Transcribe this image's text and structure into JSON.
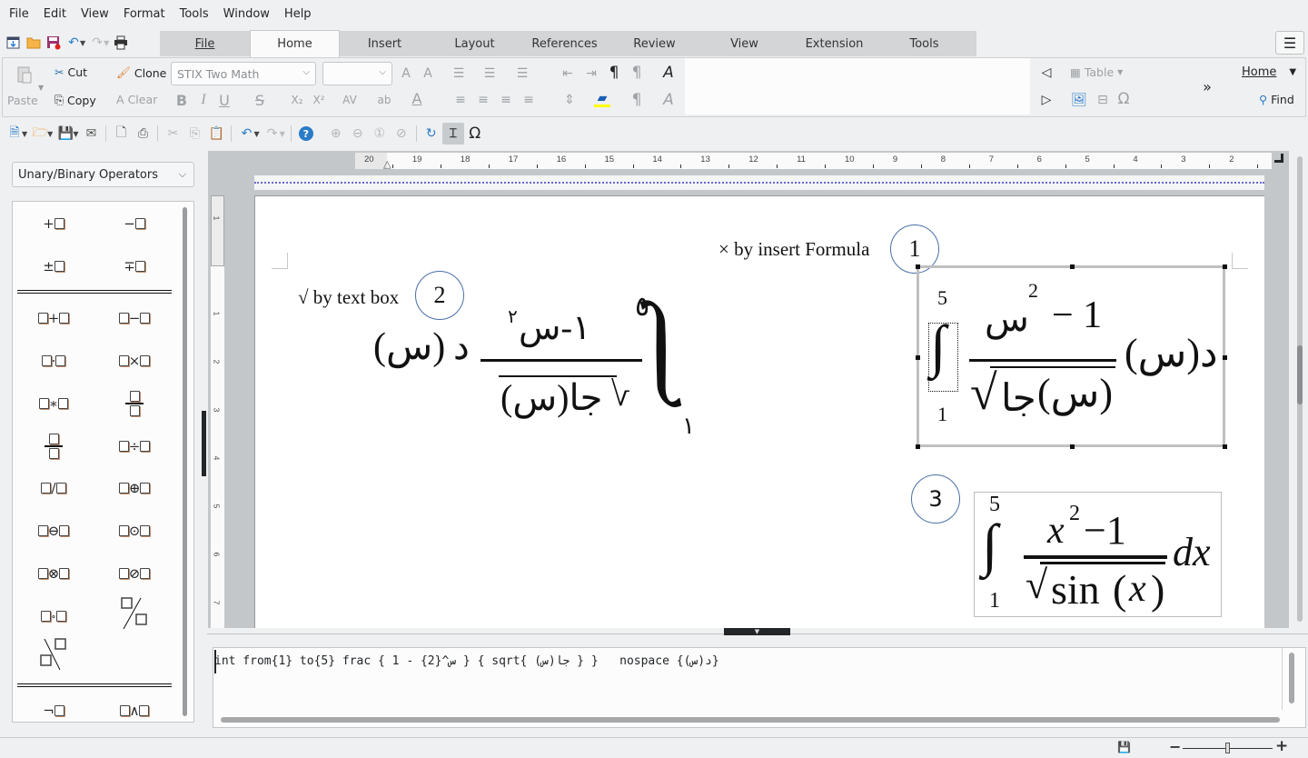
{
  "menubar": {
    "items": [
      "File",
      "Edit",
      "View",
      "Format",
      "Tools",
      "Window",
      "Help"
    ]
  },
  "quick_toolbar": {
    "icons": [
      "new-document-icon",
      "open-folder-icon",
      "save-icon",
      "undo-icon",
      "redo-icon",
      "print-icon"
    ]
  },
  "tabs": [
    {
      "label": "File",
      "active": false
    },
    {
      "label": "Home",
      "active": true
    },
    {
      "label": "Insert",
      "active": false
    },
    {
      "label": "Layout",
      "active": false
    },
    {
      "label": "References",
      "active": false
    },
    {
      "label": "Review",
      "active": false
    },
    {
      "label": "View",
      "active": false
    },
    {
      "label": "Extension",
      "active": false
    },
    {
      "label": "Tools",
      "active": false
    }
  ],
  "ribbon": {
    "paste": "Paste",
    "cut": "Cut",
    "copy": "Copy",
    "clone": "Clone",
    "clear": "Clear",
    "font_name": "STIX Two Math",
    "font_size": "",
    "table": "Table",
    "home_dropdown": "Home",
    "find": "Find",
    "bold": "B",
    "italic": "I",
    "underline": "U",
    "strike": "S",
    "subscript": "X₂",
    "superscript": "X²"
  },
  "sidebar": {
    "category": "Unary/Binary Operators",
    "elements": [
      {
        "name": "unary-plus",
        "sym": "+"
      },
      {
        "name": "unary-minus",
        "sym": "−"
      },
      {
        "name": "plus-minus",
        "sym": "±"
      },
      {
        "name": "minus-plus",
        "sym": "∓"
      },
      {
        "name": "addition",
        "sym": "+"
      },
      {
        "name": "subtraction",
        "sym": "−"
      },
      {
        "name": "multiplication-dot",
        "sym": "·"
      },
      {
        "name": "multiplication-x",
        "sym": "×"
      },
      {
        "name": "multiplication-star",
        "sym": "∗"
      },
      {
        "name": "fraction",
        "sym": "frac"
      },
      {
        "name": "fraction-small",
        "sym": "frac"
      },
      {
        "name": "division",
        "sym": "÷"
      },
      {
        "name": "slash-division",
        "sym": "/"
      },
      {
        "name": "circled-plus",
        "sym": "⊕"
      },
      {
        "name": "circled-minus",
        "sym": "⊖"
      },
      {
        "name": "circled-dot",
        "sym": "⊙"
      },
      {
        "name": "circled-times",
        "sym": "⊗"
      },
      {
        "name": "circled-slash",
        "sym": "⊘"
      },
      {
        "name": "concatenate",
        "sym": "∘"
      },
      {
        "name": "wide-slash",
        "sym": "wideslash"
      },
      {
        "name": "wide-backslash",
        "sym": "widebslash"
      },
      {
        "name": "boolean-not",
        "sym": "¬"
      },
      {
        "name": "boolean-and",
        "sym": "∧"
      }
    ]
  },
  "ruler": {
    "horizontal": [
      "20",
      "19",
      "18",
      "17",
      "16",
      "15",
      "14",
      "13",
      "12",
      "11",
      "10",
      "9",
      "8",
      "7",
      "6",
      "5",
      "4",
      "3",
      "2"
    ],
    "vertical": [
      "1",
      "1",
      "2",
      "3",
      "4",
      "5",
      "6",
      "7"
    ]
  },
  "document": {
    "label1": "× by insert Formula",
    "circle1": "1",
    "label2": "√ by text box",
    "circle2": "2",
    "circle3": "3",
    "formula2": {
      "upper": "٥",
      "lower": "١",
      "num": "١-س",
      "num_exp": "٢",
      "den": "جا(س)",
      "tail": "د",
      "tail_var": "(س)"
    },
    "formula1": {
      "upper": "5",
      "lower": "1",
      "num_var": "س",
      "num_exp": "2",
      "num_rest": "− 1",
      "den": "جا",
      "den_var": "(س)",
      "tail": "د(س)"
    },
    "formula3": {
      "upper": "5",
      "lower": "1",
      "num_var": "x",
      "num_exp": "2",
      "num_rest": "−1",
      "den_fn": "sin",
      "den_var": "x",
      "tail": "dx"
    }
  },
  "command": {
    "text": "int from{1} to{5} frac { 1 - {2}^س } { sqrt{ جا(س) } }   nospace {د(س)}"
  },
  "statusbar": {
    "zoom_slider_position": 0.5
  }
}
